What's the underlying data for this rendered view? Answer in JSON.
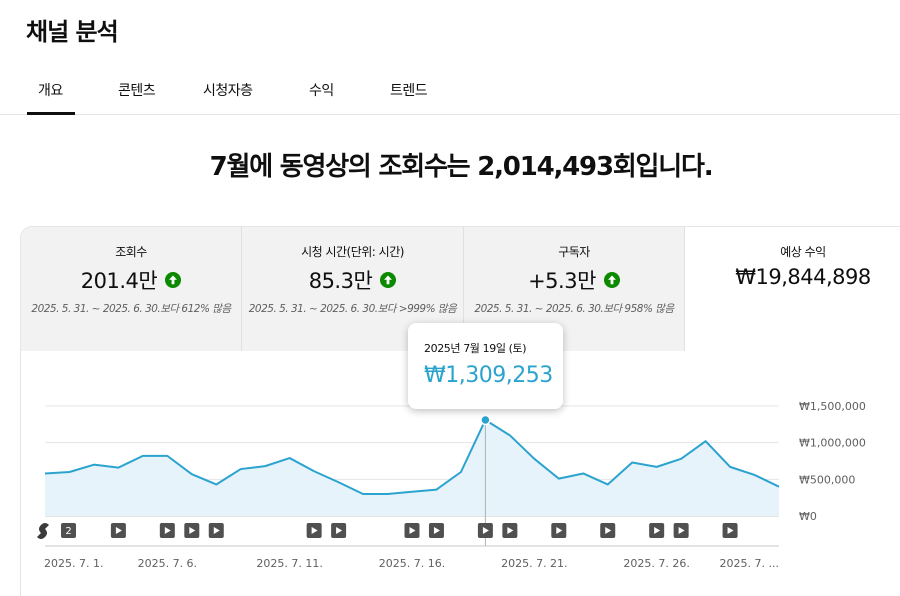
{
  "app": {
    "title": "채널 분석"
  },
  "tabs": [
    {
      "label": "개요",
      "active": true
    },
    {
      "label": "콘텐츠",
      "active": false
    },
    {
      "label": "시청자층",
      "active": false
    },
    {
      "label": "수익",
      "active": false
    },
    {
      "label": "트렌드",
      "active": false
    }
  ],
  "headline": "7월에 동영상의 조회수는 2,014,493회입니다.",
  "metrics": [
    {
      "label": "조회수",
      "value": "201.4만",
      "trend": "up",
      "compare": "2025. 5. 31. ~ 2025. 6. 30.보다 612% 많음"
    },
    {
      "label": "시청 시간(단위: 시간)",
      "value": "85.3만",
      "trend": "up",
      "compare": "2025. 5. 31. ~ 2025. 6. 30.보다 >999% 많음"
    },
    {
      "label": "구독자",
      "value": "+5.3만",
      "trend": "up",
      "compare": "2025. 5. 31. ~ 2025. 6. 30.보다 958% 많음"
    },
    {
      "label": "예상 수익",
      "value": "₩19,844,898",
      "trend": "",
      "compare": ""
    }
  ],
  "tooltip": {
    "date": "2025년 7월 19일 (토)",
    "value": "₩1,309,253"
  },
  "colors": {
    "line": "#2ba3cf",
    "fill": "#e6f3fa",
    "trend_up": "#0b8a00"
  },
  "chart_data": {
    "type": "area",
    "x": [
      "2025. 7. 1.",
      "2025. 7. 2.",
      "2025. 7. 3.",
      "2025. 7. 4.",
      "2025. 7. 5.",
      "2025. 7. 6.",
      "2025. 7. 7.",
      "2025. 7. 8.",
      "2025. 7. 9.",
      "2025. 7. 10.",
      "2025. 7. 11.",
      "2025. 7. 12.",
      "2025. 7. 13.",
      "2025. 7. 14.",
      "2025. 7. 15.",
      "2025. 7. 16.",
      "2025. 7. 17.",
      "2025. 7. 18.",
      "2025. 7. 19.",
      "2025. 7. 20.",
      "2025. 7. 21.",
      "2025. 7. 22.",
      "2025. 7. 23.",
      "2025. 7. 24.",
      "2025. 7. 25.",
      "2025. 7. 26.",
      "2025. 7. 27.",
      "2025. 7. 28.",
      "2025. 7. 29.",
      "2025. 7. 30.",
      "2025. 7. 31."
    ],
    "values": [
      580000,
      600000,
      700000,
      660000,
      820000,
      820000,
      570000,
      430000,
      640000,
      680000,
      790000,
      610000,
      460000,
      300000,
      300000,
      330000,
      360000,
      600000,
      1309253,
      1100000,
      780000,
      510000,
      580000,
      430000,
      730000,
      670000,
      780000,
      1020000,
      670000,
      560000,
      400000
    ],
    "ylim": [
      0,
      1500000
    ],
    "yticks": [
      "₩0",
      "₩500,000",
      "₩1,000,000",
      "₩1,500,000"
    ],
    "xtick_labels": [
      "2025. 7. 1.",
      "2025. 7. 6.",
      "2025. 7. 11.",
      "2025. 7. 16.",
      "2025. 7. 21.",
      "2025. 7. 26.",
      "2025. 7. ..."
    ],
    "highlight_index": 18,
    "grid": true
  },
  "markers": {
    "badge_count": "2",
    "video_day_indices": [
      3,
      5,
      6,
      7,
      11,
      12,
      15,
      16,
      18,
      19,
      21,
      23,
      25,
      26,
      28
    ]
  }
}
